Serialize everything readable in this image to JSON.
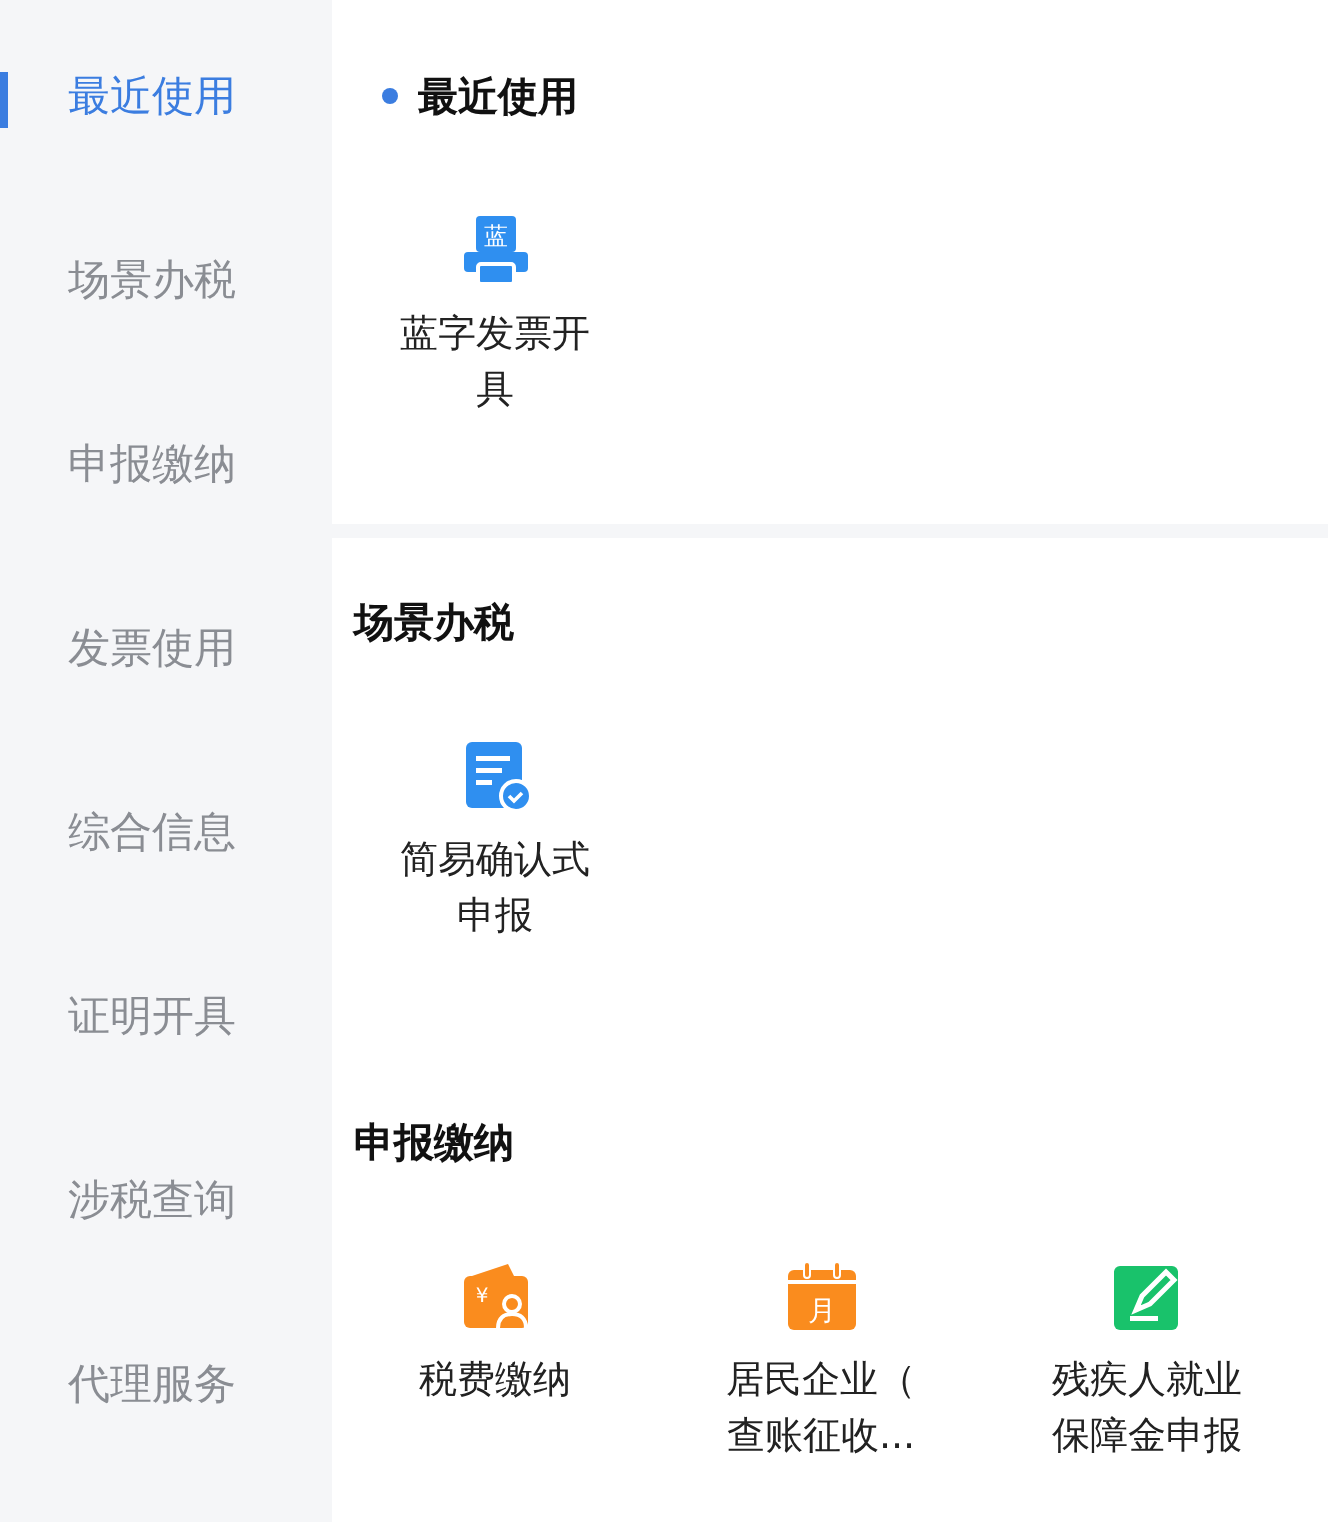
{
  "sidebar": {
    "items": [
      {
        "label": "最近使用",
        "selected": true
      },
      {
        "label": "场景办税",
        "selected": false
      },
      {
        "label": "申报缴纳",
        "selected": false
      },
      {
        "label": "发票使用",
        "selected": false
      },
      {
        "label": "综合信息",
        "selected": false
      },
      {
        "label": "证明开具",
        "selected": false
      },
      {
        "label": "涉税查询",
        "selected": false
      },
      {
        "label": "代理服务",
        "selected": false
      }
    ]
  },
  "sections": [
    {
      "title": "最近使用",
      "marker": true,
      "items": [
        {
          "label": "蓝字发票开具",
          "kind": "printer",
          "glyph": "蓝",
          "color": "#2f8ff0"
        }
      ]
    },
    {
      "title": "场景办税",
      "marker": false,
      "items": [
        {
          "label": "简易确认式申报",
          "kind": "document",
          "color": "#2f8ff0"
        }
      ]
    },
    {
      "title": "申报缴纳",
      "marker": false,
      "items": [
        {
          "label": "税费缴纳",
          "kind": "wallet",
          "glyph": "¥",
          "color": "#fa8c1e"
        },
        {
          "label": "居民企业（查账征收...",
          "kind": "calendar",
          "glyph": "月",
          "color": "#fa8c1e"
        },
        {
          "label": "残疾人就业保障金申报",
          "kind": "edit",
          "color": "#19c26b"
        }
      ]
    }
  ]
}
